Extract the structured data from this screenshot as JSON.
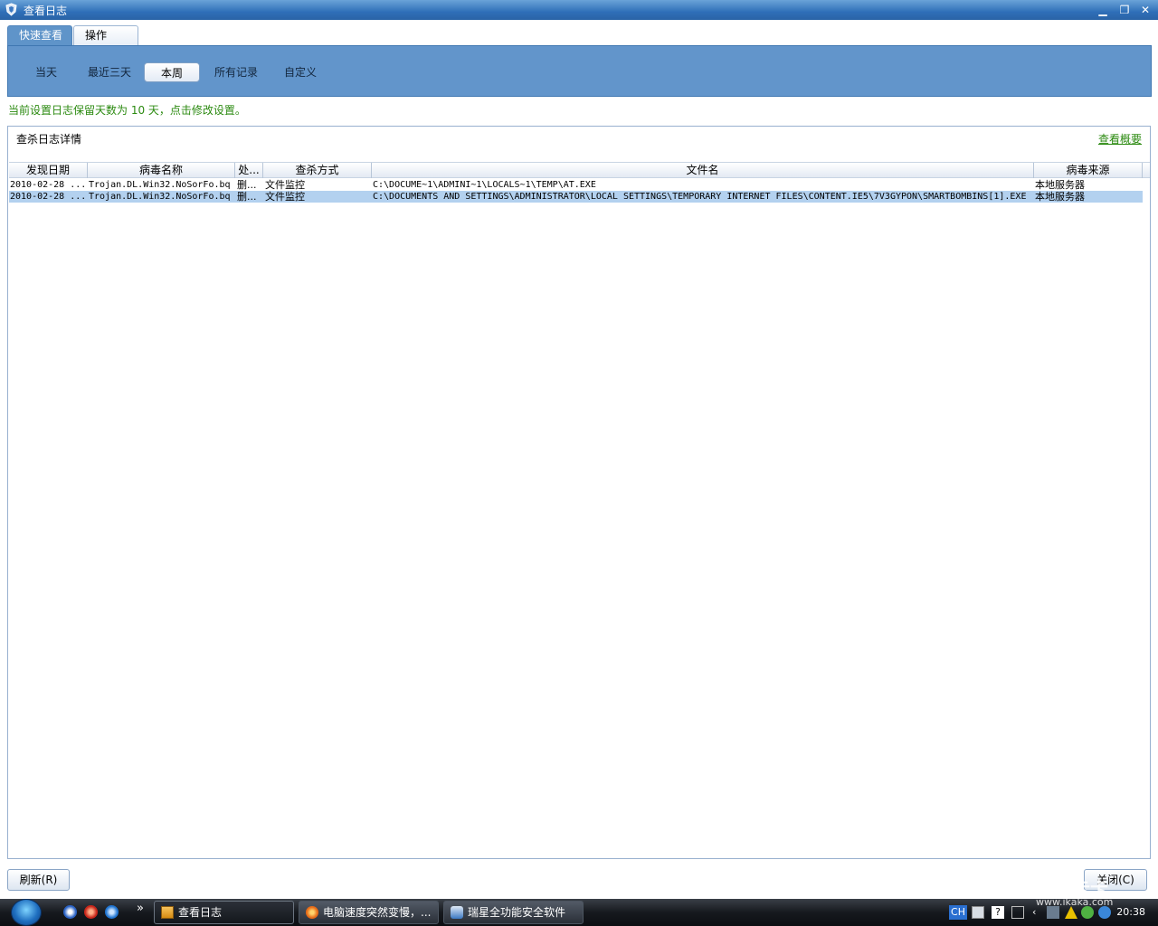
{
  "window": {
    "title": "查看日志",
    "minimize_glyph": "▁",
    "restore_glyph": "❐",
    "close_glyph": "✕"
  },
  "top_tabs": [
    {
      "label": "快速查看",
      "active": true
    },
    {
      "label": "操作",
      "active": false
    }
  ],
  "filters": [
    {
      "label": "当天",
      "selected": false
    },
    {
      "label": "最近三天",
      "selected": false
    },
    {
      "label": "本周",
      "selected": true
    },
    {
      "label": "所有记录",
      "selected": false
    },
    {
      "label": "自定义",
      "selected": false
    }
  ],
  "notice": "当前设置日志保留天数为 10 天，点击修改设置。",
  "panel": {
    "title": "查杀日志详情",
    "summary_link": "查看概要"
  },
  "table": {
    "columns": [
      "发现日期",
      "病毒名称",
      "处...",
      "查杀方式",
      "文件名",
      "病毒来源"
    ],
    "rows": [
      [
        "2010-02-28 ...",
        "Trojan.DL.Win32.NoSorFo.bq",
        "删...",
        "文件监控",
        "C:\\DOCUME~1\\ADMINI~1\\LOCALS~1\\TEMP\\AT.EXE",
        "本地服务器"
      ],
      [
        "2010-02-28 ...",
        "Trojan.DL.Win32.NoSorFo.bq",
        "删...",
        "文件监控",
        "C:\\DOCUMENTS AND SETTINGS\\ADMINISTRATOR\\LOCAL SETTINGS\\TEMPORARY INTERNET FILES\\CONTENT.IE5\\7V3GYPON\\SMARTBOMBINS[1].EXE",
        "本地服务器"
      ]
    ],
    "selected_row": 1
  },
  "buttons": {
    "refresh": "刷新(R)",
    "close": "关闭(C)"
  },
  "taskbar": {
    "quick_launch_more": "»",
    "tasks": [
      {
        "label": "查看日志",
        "active": true
      },
      {
        "label": "电脑速度突然变慢，...",
        "active": false
      },
      {
        "label": "瑞星全功能安全软件",
        "active": false
      }
    ],
    "ime": "CH",
    "clock": "20:38"
  },
  "watermark": "瑞星卡卡",
  "watermark_url": "www.ikaka.com",
  "colors": {
    "accent_blue": "#6295cb",
    "notice_green": "#2b8a10",
    "selection": "#b3d1ef"
  }
}
